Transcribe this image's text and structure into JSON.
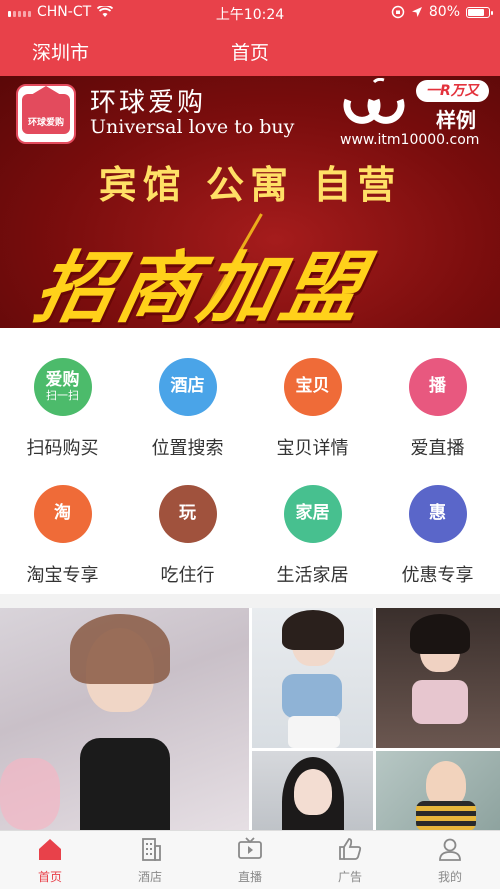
{
  "status": {
    "carrier": "CHN-CT",
    "time": "上午10:24",
    "battery": "80%",
    "battery_level": 0.8
  },
  "header": {
    "city": "深圳市",
    "title": "首页"
  },
  "banner": {
    "logo_text": "环球爱购",
    "brand_cn": "环球爱购",
    "brand_en": "Universal love to buy",
    "watermark_badge": "一R万又",
    "watermark_sample": "样例",
    "watermark_url": "www.itm10000.com",
    "line2": "宾馆 公寓 自营",
    "line3": "招商加盟",
    "slides": 3,
    "active_slide": 1
  },
  "menu": {
    "items": [
      {
        "icon_text": "爱购",
        "icon_sub": "扫一扫",
        "label": "扫码购买",
        "color": "#4cbb6b",
        "icon": "scan-buy-icon"
      },
      {
        "icon_text": "酒店",
        "icon_sub": "",
        "label": "位置搜索",
        "color": "#4aa4e8",
        "icon": "hotel-icon"
      },
      {
        "icon_text": "宝贝",
        "icon_sub": "",
        "label": "宝贝详情",
        "color": "#ef6b38",
        "icon": "baby-icon"
      },
      {
        "icon_text": "播",
        "icon_sub": "",
        "label": "爱直播",
        "color": "#e8587f",
        "icon": "live-icon"
      },
      {
        "icon_text": "淘",
        "icon_sub": "",
        "label": "淘宝专享",
        "color": "#ef6b38",
        "icon": "taobao-icon"
      },
      {
        "icon_text": "玩",
        "icon_sub": "",
        "label": "吃住行",
        "color": "#a0523d",
        "icon": "play-icon"
      },
      {
        "icon_text": "家居",
        "icon_sub": "",
        "label": "生活家居",
        "color": "#47c08f",
        "icon": "home-living-icon"
      },
      {
        "icon_text": "惠",
        "icon_sub": "",
        "label": "优惠专享",
        "color": "#5a66c9",
        "icon": "discount-icon"
      }
    ]
  },
  "tabs": [
    {
      "label": "首页",
      "icon": "home-icon",
      "active": true
    },
    {
      "label": "酒店",
      "icon": "building-icon",
      "active": false
    },
    {
      "label": "直播",
      "icon": "tv-icon",
      "active": false
    },
    {
      "label": "广告",
      "icon": "thumbs-up-icon",
      "active": false
    },
    {
      "label": "我的",
      "icon": "profile-icon",
      "active": false
    }
  ],
  "colors": {
    "brand_red": "#e8414a",
    "banner_dark": "#7a0d0d",
    "banner_yellow": "#ffd11a"
  }
}
